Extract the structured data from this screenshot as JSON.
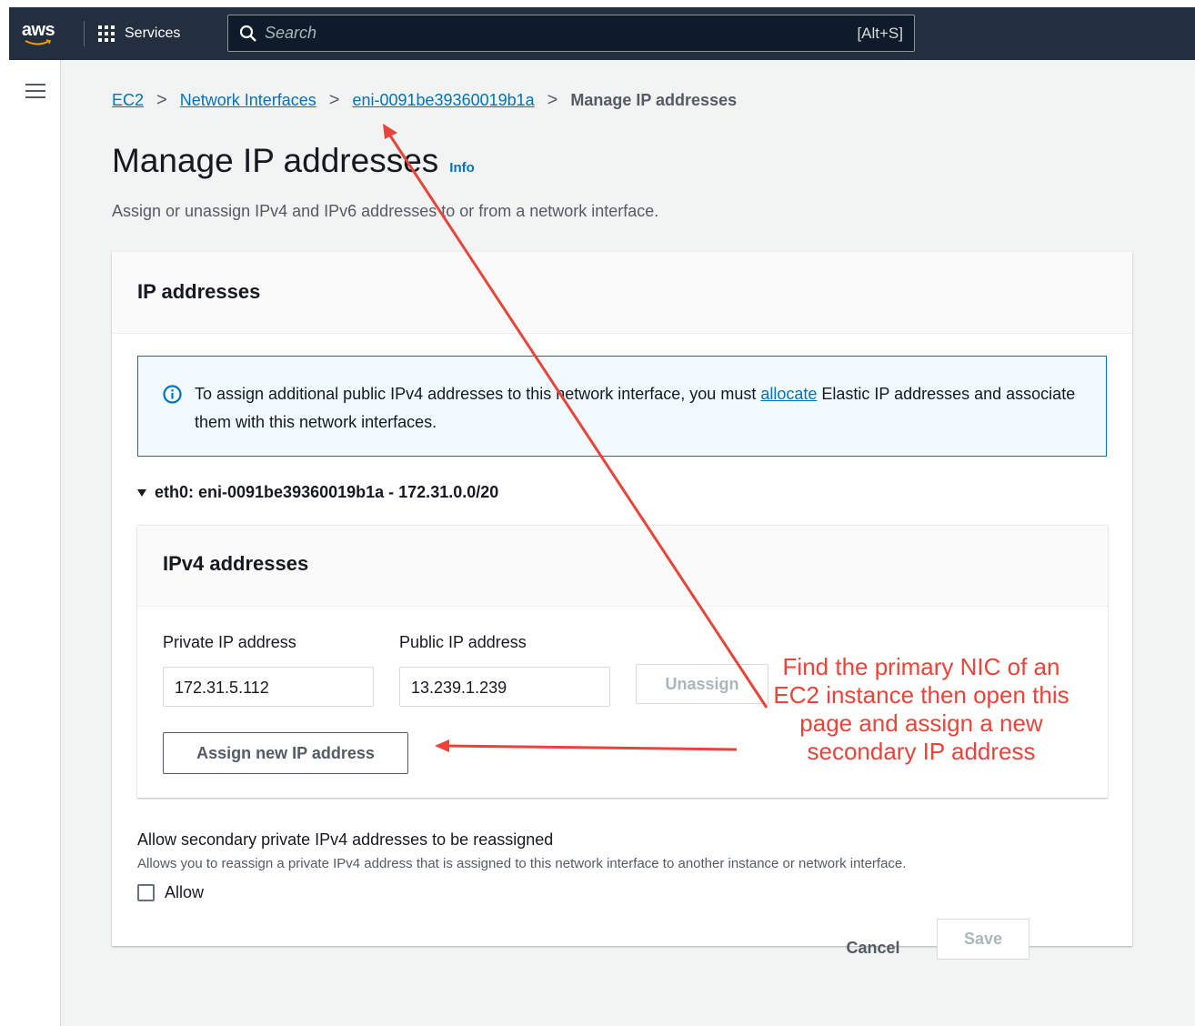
{
  "topnav": {
    "logo_text": "aws",
    "services_label": "Services",
    "search_placeholder": "Search",
    "search_shortcut": "[Alt+S]"
  },
  "breadcrumb": {
    "items": [
      "EC2",
      "Network Interfaces",
      "eni-0091be39360019b1a"
    ],
    "current": "Manage IP addresses"
  },
  "page": {
    "title": "Manage IP addresses",
    "info_label": "Info",
    "description": "Assign or unassign IPv4 and IPv6 addresses to or from a network interface."
  },
  "ip_addresses": {
    "header": "IP addresses",
    "alert": {
      "text_before": "To assign additional public IPv4 addresses to this network interface, you must ",
      "link": "allocate",
      "text_after": " Elastic IP addresses and associate them with this network interfaces."
    },
    "eni_toggle": "eth0: eni-0091be39360019b1a - 172.31.0.0/20",
    "ipv4": {
      "header": "IPv4 addresses",
      "private_label": "Private IP address",
      "public_label": "Public IP address",
      "private_value": "172.31.5.112",
      "public_value": "13.239.1.239",
      "unassign_label": "Unassign",
      "assign_label": "Assign new IP address"
    },
    "reassign": {
      "title": "Allow secondary private IPv4 addresses to be reassigned",
      "description": "Allows you to reassign a private IPv4 address that is assigned to this network interface to another instance or network interface.",
      "checkbox_label": "Allow",
      "checked": false
    }
  },
  "footer": {
    "cancel_label": "Cancel",
    "save_label": "Save"
  },
  "annotation": {
    "text": "Find the primary NIC of an EC2 instance then open this page and assign a new secondary IP address",
    "color": "#e8443a"
  },
  "colors": {
    "nav_bg": "#232f3e",
    "link": "#0073bb",
    "alert_bg": "#f1faff"
  }
}
